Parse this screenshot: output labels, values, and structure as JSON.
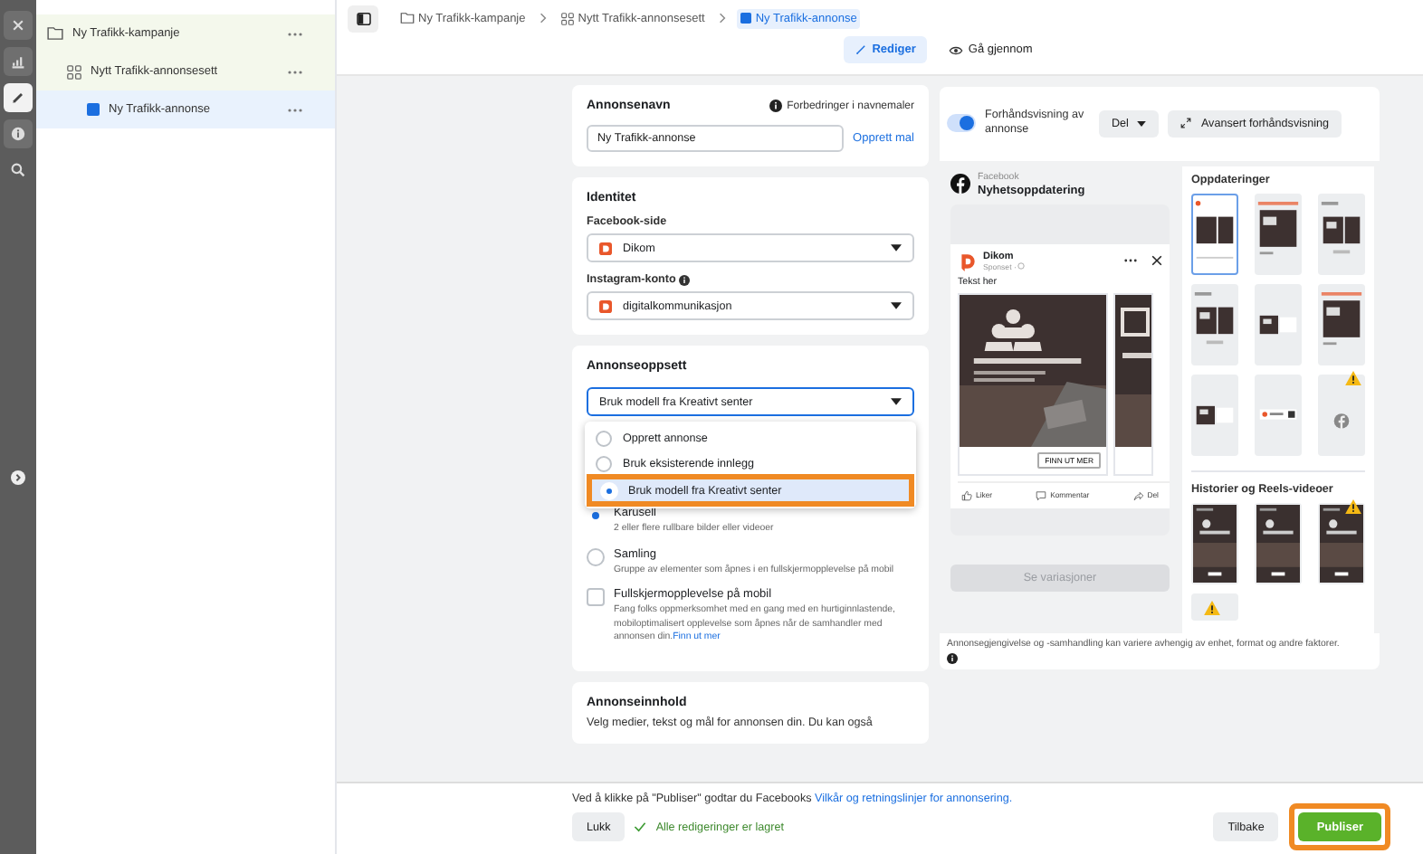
{
  "rail": [
    {
      "kind": "close",
      "selected": false
    },
    {
      "kind": "chart",
      "selected": false
    },
    {
      "kind": "edit",
      "selected": true
    },
    {
      "kind": "info",
      "selected": false
    },
    {
      "kind": "search",
      "selected": false
    }
  ],
  "tree": [
    {
      "label": "Ny Trafikk-kampanje",
      "kind": "campaign",
      "selected": false,
      "children": [
        {
          "label": "Nytt Trafikk-annonsesett",
          "kind": "adset",
          "selected": false,
          "children": [
            {
              "label": "Ny Trafikk-annonse",
              "kind": "ad",
              "selected": true
            }
          ]
        }
      ]
    }
  ],
  "breadcrumbs": [
    {
      "label": "Ny Trafikk-kampanje",
      "kind": "campaign",
      "selected": false
    },
    {
      "label": "Nytt Trafikk-annonsesett",
      "kind": "adset",
      "selected": false
    },
    {
      "label": "Ny Trafikk-annonse",
      "kind": "ad",
      "selected": true
    }
  ],
  "mode_tabs": [
    {
      "label": "Rediger",
      "kind": "edit",
      "selected": true
    },
    {
      "label": "Gå gjennom",
      "kind": "review",
      "selected": false
    }
  ],
  "ad_name": {
    "title": "Annonsenavn",
    "hint": "Forbedringer i navnemaler",
    "value": "Ny Trafikk-annonse",
    "link": "Opprett mal"
  },
  "identity": {
    "title": "Identitet",
    "fields": [
      {
        "label": "Facebook-side",
        "value": "Dikom",
        "info": false
      },
      {
        "label": "Instagram-konto",
        "value": "digitalkommunikasjon",
        "info": true
      }
    ]
  },
  "setup": {
    "title": "Annonseoppsett",
    "value": "Bruk modell fra Kreativt senter",
    "menu": [
      {
        "label": "Opprett annonse",
        "selected": false,
        "highlighted": false
      },
      {
        "label": "Bruk eksisterende innlegg",
        "selected": false,
        "highlighted": false
      },
      {
        "label": "Bruk modell fra Kreativt senter",
        "selected": true,
        "highlighted": true
      }
    ],
    "formats": [
      {
        "kind": "radio",
        "label": "Karusell",
        "description": "2 eller flere rullbare bilder eller videoer",
        "selected": true
      },
      {
        "kind": "radio",
        "label": "Samling",
        "description": "Gruppe av elementer som åpnes i en fullskjermopplevelse på mobil",
        "selected": false
      },
      {
        "kind": "checkbox",
        "label": "Fullskjermopplevelse på mobil",
        "description": "Fang folks oppmerksomhet med en gang med en hurtiginnlastende, mobiloptimalisert opplevelse som åpnes når de samhandler med annonsen din.",
        "link": "Finn ut mer",
        "checked": false
      }
    ]
  },
  "content": {
    "title": "Annonseinnhold",
    "description": "Velg medier, tekst og mål for annonsen din. Du kan også"
  },
  "preview": {
    "toggle_label": "Forhåndsvisning av annonse",
    "on": true,
    "share": "Del",
    "advanced": "Avansert forhåndsvisning",
    "platform": "Facebook",
    "placement": "Nyhetsoppdatering",
    "post": {
      "page": "Dikom",
      "sponsored": "Sponset ·",
      "text": "Tekst her",
      "cta": "FINN UT MER",
      "actions": [
        {
          "label": "Liker",
          "kind": "like"
        },
        {
          "label": "Kommentar",
          "kind": "comment"
        },
        {
          "label": "Del",
          "kind": "share"
        }
      ]
    },
    "variations": {
      "label": "Se variasjoner",
      "disabled": true
    },
    "updates_title": "Oppdateringer",
    "updates": [
      {
        "kind": "feed",
        "selected": true,
        "warning": false
      },
      {
        "kind": "full",
        "selected": false,
        "warning": false
      },
      {
        "kind": "carousel",
        "selected": false,
        "warning": false
      },
      {
        "kind": "carousel",
        "selected": false,
        "warning": false
      },
      {
        "kind": "small",
        "selected": false,
        "warning": false
      },
      {
        "kind": "full",
        "selected": false,
        "warning": false
      },
      {
        "kind": "small",
        "selected": false,
        "warning": false
      },
      {
        "kind": "tiny",
        "selected": false,
        "warning": false
      },
      {
        "kind": "logo",
        "selected": false,
        "warning": true
      }
    ],
    "stories_title": "Historier og Reels-videoer",
    "stories": [
      {
        "kind": "story",
        "selected": false,
        "warning": false
      },
      {
        "kind": "story",
        "selected": false,
        "warning": false
      },
      {
        "kind": "story",
        "selected": false,
        "warning": true
      },
      {
        "kind": "empty",
        "selected": false,
        "warning": true
      }
    ],
    "disclaimer": "Annonsegjengivelse og -samhandling kan variere avhengig av enhet, format og andre faktorer."
  },
  "footer": {
    "terms": "Ved å klikke på \"Publiser\" godtar du Facebooks",
    "terms_link": "Vilkår og retningslinjer for annonsering.",
    "close": "Lukk",
    "saved": "Alle redigeringer er lagret",
    "back": "Tilbake",
    "publish": "Publiser",
    "publish_highlighted": true
  }
}
